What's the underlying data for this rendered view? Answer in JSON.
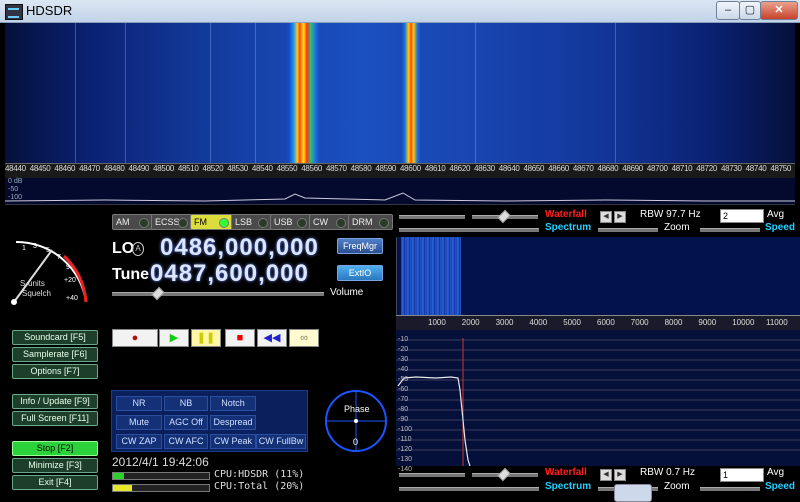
{
  "window": {
    "title": "HDSDR",
    "controls": {
      "minimize": "–",
      "maximize": "▢",
      "close": "✕"
    }
  },
  "rf_scale_ticks": [
    "48440",
    "48450",
    "48460",
    "48470",
    "48480",
    "48490",
    "48500",
    "48510",
    "48520",
    "48530",
    "48540",
    "48550",
    "48560",
    "48570",
    "48580",
    "48590",
    "48600",
    "48610",
    "48620",
    "48630",
    "48640",
    "48650",
    "48660",
    "48670",
    "48680",
    "48690",
    "48700",
    "48710",
    "48720",
    "48730",
    "48740",
    "48750"
  ],
  "rf_strip_db": [
    "0 dB",
    "-50",
    "-100"
  ],
  "smeter": {
    "scale": [
      "1",
      "3",
      "5",
      "7",
      "9",
      "+20",
      "+40"
    ],
    "units_label": "S-units",
    "squelch_label": "Squelch"
  },
  "side_buttons": [
    {
      "id": "soundcard",
      "label": "Soundcard  [F5]"
    },
    {
      "id": "samplerate",
      "label": "Samplerate [F6]"
    },
    {
      "id": "options",
      "label": "Options     [F7]"
    },
    {
      "id": "info",
      "label": "Info / Update [F9]"
    },
    {
      "id": "fullscreen",
      "label": "Full Screen [F11]"
    },
    {
      "id": "stop",
      "label": "Stop        [F2]"
    },
    {
      "id": "minimize",
      "label": "Minimize   [F3]"
    },
    {
      "id": "exit",
      "label": "Exit        [F4]"
    }
  ],
  "modes": [
    "AM",
    "ECSS",
    "FM",
    "LSB",
    "USB",
    "CW",
    "DRM"
  ],
  "active_mode": "FM",
  "lo": {
    "label": "LO",
    "badge": "A",
    "value": "0486,000,000"
  },
  "tune": {
    "label": "Tune",
    "value": "0487,600,000"
  },
  "buttons": {
    "freqmgr": "FreqMgr",
    "extio": "ExtIO"
  },
  "volume_label": "Volume",
  "transport": {
    "record": "●",
    "play": "▶",
    "pause": "❚❚",
    "stop": "■",
    "rewind": "◀◀",
    "loop": "∞"
  },
  "dsp_buttons": [
    [
      "NR",
      "NB",
      "Notch"
    ],
    [
      "Mute",
      "AGC Off",
      "Despread"
    ],
    [
      "CW ZAP",
      "CW AFC",
      "CW Peak",
      "CW FullBw"
    ]
  ],
  "phase": {
    "label": "Phase",
    "value": "0"
  },
  "datetime": "2012/4/1 19:42:06",
  "cpu": [
    {
      "text": "CPU:HDSDR  (11%)",
      "percent": 11,
      "color": "#2ad22a"
    },
    {
      "text": "CPU:Total  (20%)",
      "percent": 20,
      "color": "#e6e62a"
    }
  ],
  "rf_controls": {
    "waterfall": "Waterfall",
    "spectrum": "Spectrum",
    "rbw": "RBW 97.7 Hz",
    "zoom": "Zoom",
    "avg_value": "2",
    "avg": "Avg",
    "speed": "Speed"
  },
  "af_axis_ticks": [
    "1000",
    "2000",
    "3000",
    "4000",
    "5000",
    "6000",
    "7000",
    "8000",
    "9000",
    "10000",
    "11000"
  ],
  "af_db_ticks": [
    "-10",
    "-20",
    "-30",
    "-40",
    "-50",
    "-60",
    "-70",
    "-80",
    "-90",
    "-100",
    "-110",
    "-120",
    "-130",
    "-140"
  ],
  "af_controls": {
    "waterfall": "Waterfall",
    "rbw": "RBW  0.7 Hz",
    "avg_value": "1",
    "avg": "Avg",
    "spectrum": "Spectrum",
    "zoom": "Zoom",
    "speed": "Speed"
  },
  "colors": {
    "waterfall_bg": "#1a45b0",
    "accent_red": "#ff2020",
    "accent_cyan": "#20d0ff",
    "stop_green": "#2cd23a",
    "freq_text": "#dde6ff"
  }
}
